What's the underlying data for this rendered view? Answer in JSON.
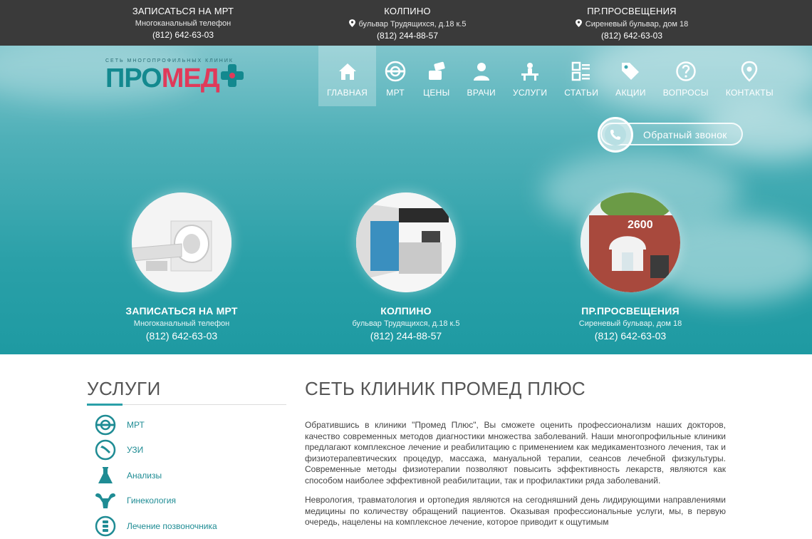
{
  "topbar": [
    {
      "title": "ЗАПИСАТЬСЯ НА МРТ",
      "sub": "Многоканальный телефон",
      "phone": "(812) 642-63-03",
      "pin": false
    },
    {
      "title": "КОЛПИНО",
      "sub": "бульвар Трудящихся, д.18 к.5",
      "phone": "(812) 244-88-57",
      "pin": true
    },
    {
      "title": "ПР.ПРОСВЕЩЕНИЯ",
      "sub": "Сиреневый бульвар, дом 18",
      "phone": "(812) 642-63-03",
      "pin": true
    }
  ],
  "logo": {
    "tagline": "СЕТЬ МНОГОПРОФИЛЬНЫХ КЛИНИК",
    "part1": "ПРО",
    "part2": "МЕД"
  },
  "nav": [
    {
      "label": "ГЛАВНАЯ",
      "icon": "home-icon",
      "active": true
    },
    {
      "label": "МРТ",
      "icon": "mri-icon"
    },
    {
      "label": "ЦЕНЫ",
      "icon": "prices-icon"
    },
    {
      "label": "ВРАЧИ",
      "icon": "doctor-icon"
    },
    {
      "label": "УСЛУГИ",
      "icon": "services-icon"
    },
    {
      "label": "СТАТЬИ",
      "icon": "articles-icon"
    },
    {
      "label": "АКЦИИ",
      "icon": "tag-icon"
    },
    {
      "label": "ВОПРОСЫ",
      "icon": "question-icon"
    },
    {
      "label": "КОНТАКТЫ",
      "icon": "location-pin-icon"
    }
  ],
  "callback": {
    "label": "Обратный звонок",
    "icon": "phone-icon"
  },
  "locations": [
    {
      "title": "ЗАПИСАТЬСЯ НА МРТ",
      "sub": "Многоканальный телефон",
      "phone": "(812) 642-63-03",
      "image": "mri-scanner-image"
    },
    {
      "title": "КОЛПИНО",
      "sub": "бульвар Трудящихся, д.18 к.5",
      "phone": "(812) 244-88-57",
      "image": "clinic-reception-image"
    },
    {
      "title": "ПР.ПРОСВЕЩЕНИЯ",
      "sub": "Сиреневый бульвар, дом 18",
      "phone": "(812) 642-63-03",
      "image": "clinic-building-image",
      "sign": "2600"
    }
  ],
  "services": {
    "title": "УСЛУГИ",
    "items": [
      {
        "label": "МРТ",
        "icon": "mri-icon"
      },
      {
        "label": "УЗИ",
        "icon": "ultrasound-icon"
      },
      {
        "label": "Анализы",
        "icon": "flask-icon"
      },
      {
        "label": "Гинекология",
        "icon": "uterus-icon"
      },
      {
        "label": "Лечение позвоночника",
        "icon": "spine-icon"
      }
    ]
  },
  "main": {
    "title": "СЕТЬ КЛИНИК ПРОМЕД ПЛЮС",
    "p1": "Обратившись в клиники \"Промед Плюс\", Вы сможете оценить профессионализм наших докторов, качество современных методов диагностики множества заболеваний. Наши многопрофильные клиники предлагают комплексное лечение и реабилитацию с применением как медикаментозного лечения, так и физиотерапевтических процедур, массажа, мануальной терапии, сеансов лечебной физкультуры. Современные методы физиотерапии позволяют повысить эффективность лекарств, являются как способом наиболее эффективной реабилитации, так и профилактики ряда заболеваний.",
    "p2": "Неврология, травматология и ортопедия являются на сегодняшний день лидирующими направлениями медицины по количеству обращений пациентов. Оказывая профессиональные услуги, мы, в первую очередь, нацелены на комплексное лечение, которое приводит к ощутимым"
  },
  "colors": {
    "teal": "#2aa0a8",
    "logo_red": "#e03a5a",
    "topbar": "#3a3a3a"
  }
}
